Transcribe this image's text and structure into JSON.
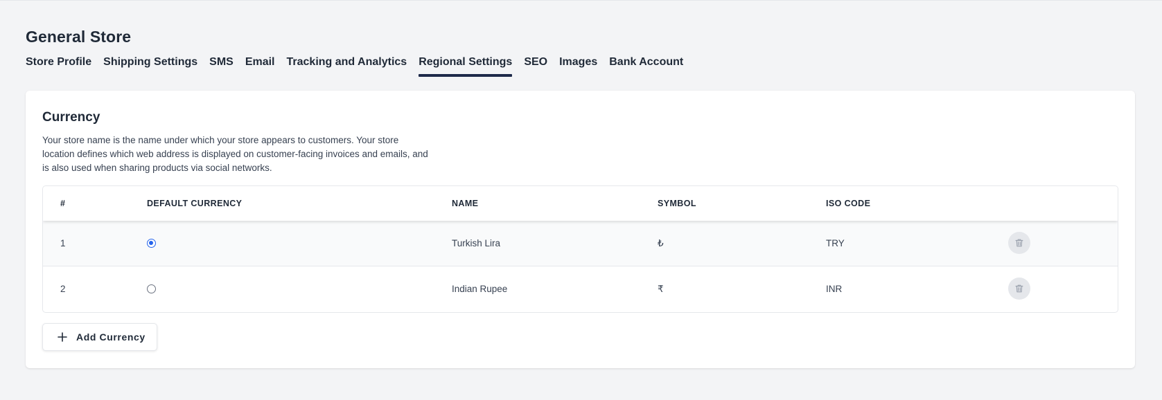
{
  "store": {
    "title": "General Store"
  },
  "tabs": [
    {
      "label": "Store Profile"
    },
    {
      "label": "Shipping Settings"
    },
    {
      "label": "SMS"
    },
    {
      "label": "Email"
    },
    {
      "label": "Tracking and Analytics"
    },
    {
      "label": "Regional Settings",
      "active": true
    },
    {
      "label": "SEO"
    },
    {
      "label": "Images"
    },
    {
      "label": "Bank Account"
    }
  ],
  "currency": {
    "title": "Currency",
    "description": "Your store name is the name under which your store appears to customers. Your store location defines which web address is displayed on customer-facing invoices and emails, and is also used when sharing products via social networks.",
    "columns": {
      "num": "#",
      "default": "DEFAULT CURRENCY",
      "name": "NAME",
      "symbol": "SYMBOL",
      "iso": "ISO CODE"
    },
    "rows": [
      {
        "num": "1",
        "default": true,
        "name": "Turkish Lira",
        "symbol": "₺",
        "iso": "TRY"
      },
      {
        "num": "2",
        "default": false,
        "name": "Indian Rupee",
        "symbol": "₹",
        "iso": "INR"
      }
    ],
    "add_label": "Add Currency"
  },
  "colors": {
    "accent": "#2563eb",
    "tab_underline": "#1e2a4a",
    "background": "#f3f4f6"
  },
  "icons": {
    "delete": "trash-icon",
    "add": "plus-icon"
  }
}
